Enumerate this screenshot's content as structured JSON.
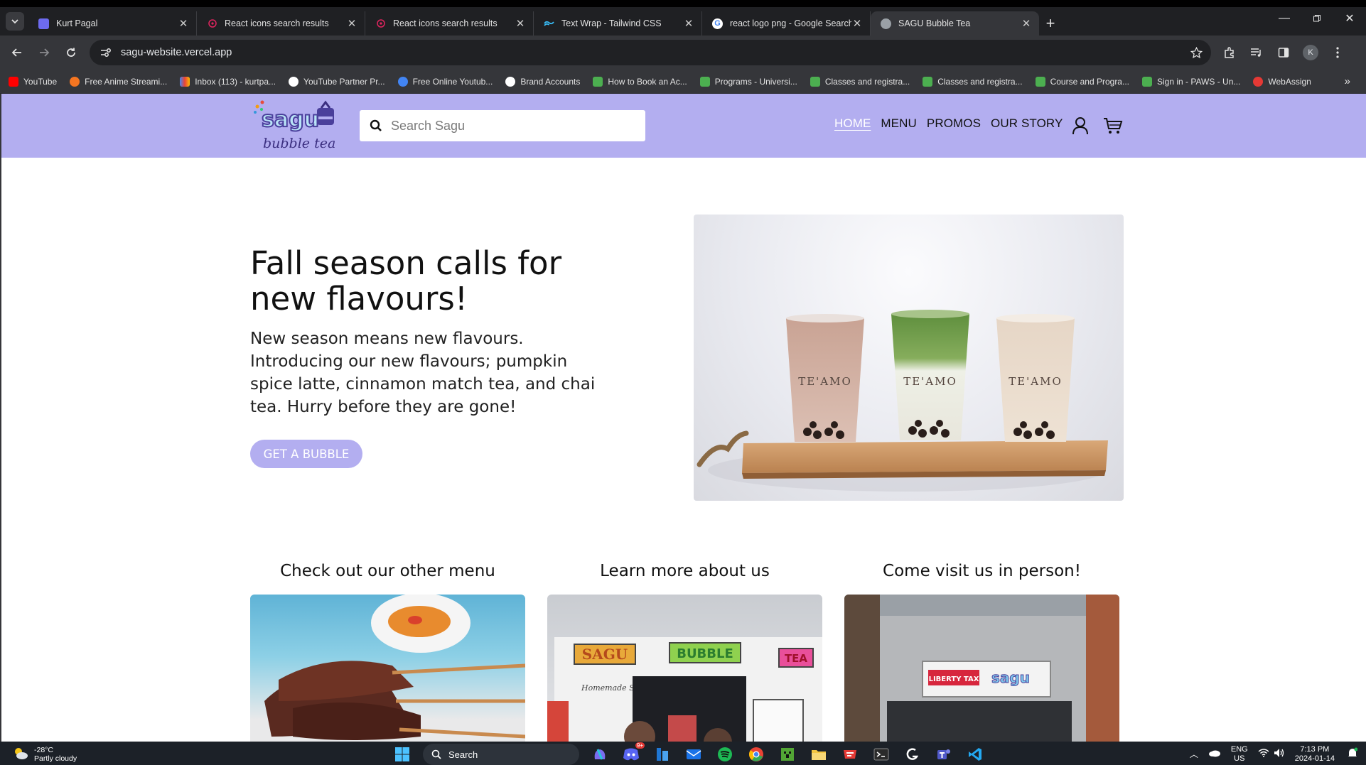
{
  "browser": {
    "tabs": [
      {
        "title": "Kurt Pagal",
        "color": "#6d6bf0",
        "icon": "portfolio-icon"
      },
      {
        "title": "React icons search results",
        "color": "#e0245e",
        "icon": "react-icons-icon"
      },
      {
        "title": "React icons search results",
        "color": "#e0245e",
        "icon": "react-icons-icon"
      },
      {
        "title": "Text Wrap - Tailwind CSS",
        "color": "#38bdf8",
        "icon": "tailwind-icon"
      },
      {
        "title": "react logo png - Google Search",
        "color": "#ffffff",
        "icon": "google-icon"
      },
      {
        "title": "SAGU Bubble Tea",
        "color": "#9aa0a6",
        "icon": "globe-icon",
        "active": true
      }
    ],
    "url": "sagu-website.vercel.app",
    "profile_initial": "K",
    "bookmarks": [
      {
        "label": "YouTube",
        "color": "#ff0000"
      },
      {
        "label": "Free Anime Streami...",
        "color": "#f47521"
      },
      {
        "label": "Inbox (113) - kurtpa...",
        "color": "#ea4335"
      },
      {
        "label": "YouTube Partner Pr...",
        "color": "#ffffff"
      },
      {
        "label": "Free Online Youtub...",
        "color": "#4285f4"
      },
      {
        "label": "Brand Accounts",
        "color": "#ffffff"
      },
      {
        "label": "How to Book an Ac...",
        "color": "#4caf50"
      },
      {
        "label": "Programs - Universi...",
        "color": "#4caf50"
      },
      {
        "label": "Classes and registra...",
        "color": "#4caf50"
      },
      {
        "label": "Classes and registra...",
        "color": "#4caf50"
      },
      {
        "label": "Course and Progra...",
        "color": "#4caf50"
      },
      {
        "label": "Sign in - PAWS - Un...",
        "color": "#4caf50"
      },
      {
        "label": "WebAssign",
        "color": "#e53935"
      }
    ]
  },
  "site": {
    "logo_top": "sagu",
    "logo_bottom": "bubble tea",
    "search_placeholder": "Search Sagu",
    "nav": [
      "HOME",
      "MENU",
      "PROMOS",
      "OUR STORY"
    ],
    "hero_title": "Fall season calls for new flavours!",
    "hero_text": "New season means new flavours. Introducing our new flavours; pumpkin spice latte, cinnamon match tea, and chai tea. Hurry before they are gone!",
    "hero_button": "GET A BUBBLE",
    "cup_brand": "TE'AMO",
    "sections": [
      {
        "title": "Check out our other menu"
      },
      {
        "title": "Learn more about us"
      },
      {
        "title": "Come visit us in person!"
      }
    ],
    "truck_signs": [
      "SAGU",
      "BUBBLE",
      "TEA"
    ],
    "truck_tagline": "Homemade Scratch Recipes",
    "store_signs": [
      "LIBERTY TAX",
      "sagu"
    ],
    "colors": {
      "accent": "#b3aef0"
    }
  },
  "taskbar": {
    "temp": "-28°C",
    "weather": "Partly cloudy",
    "search": "Search",
    "lang_top": "ENG",
    "lang_bottom": "US",
    "time": "7:13 PM",
    "date": "2024-01-14",
    "badge": "9+"
  }
}
